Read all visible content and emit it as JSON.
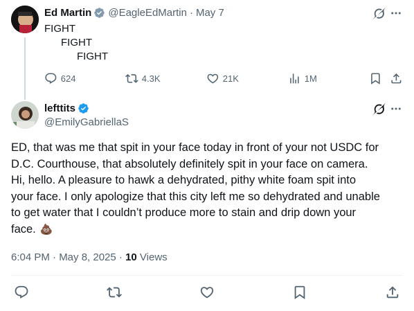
{
  "parent_tweet": {
    "author_name": "Ed Martin",
    "author_handle": "@EagleEdMartin",
    "separator": "·",
    "date": "May 7",
    "lines": [
      "FIGHT",
      "FIGHT",
      "FIGHT"
    ],
    "stats": {
      "replies": "624",
      "reposts": "4.3K",
      "likes": "21K",
      "views": "1M"
    }
  },
  "main_tweet": {
    "author_name": "lefttits",
    "author_handle": "@EmilyGabriellaS",
    "body_lines": [
      "ED, that was me that spit in your face today in front of your not USDC for",
      "D.C. Courthouse, that absolutely definitely spit in your face on camera.",
      "Hi, hello. A pleasure to hawk a dehydrated, pithy white foam spit into",
      "your face. I only apologize that this city left me so dehydrated and unable",
      "to get water that I couldn’t produce more to stain and drip down your",
      "face."
    ],
    "emoji": "💩",
    "timestamp": "6:04 PM · May 8, 2025 · ",
    "views_count": "10",
    "views_label": " Views"
  },
  "colors": {
    "text": "#0f1419",
    "muted": "#536471",
    "verified": "#1d9bf0",
    "divider": "#eff3f4"
  },
  "icons": {
    "grok": "grok-icon",
    "more": "more-icon",
    "reply": "reply-icon",
    "repost": "repost-icon",
    "like": "like-icon",
    "views": "views-icon",
    "bookmark": "bookmark-icon",
    "share": "share-icon"
  }
}
